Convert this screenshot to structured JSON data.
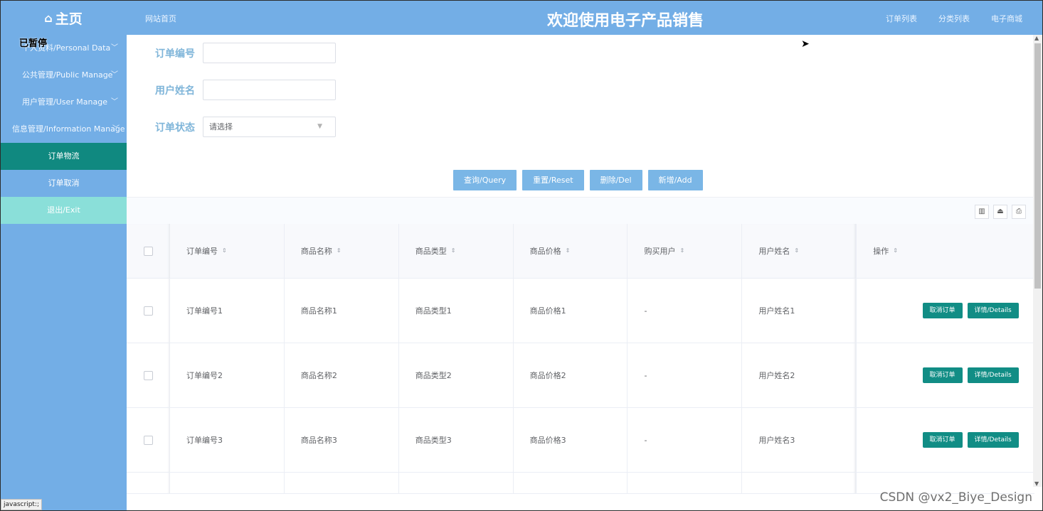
{
  "header": {
    "brand": "主页",
    "home_link": "网站首页",
    "title": "欢迎使用电子产品销售",
    "right_links": [
      "订单列表",
      "分类列表",
      "电子商城"
    ]
  },
  "sidebar": {
    "overlay": "已暂停",
    "groups": [
      {
        "label": "个人资料/Personal Data"
      },
      {
        "label": "公共管理/Public Manage"
      },
      {
        "label": "用户管理/User Manage"
      },
      {
        "label": "信息管理/Information Manage"
      }
    ],
    "subs": [
      {
        "label": "订单物流"
      },
      {
        "label": "订单取消"
      },
      {
        "label": "退出/Exit"
      }
    ],
    "status_url": "javascript:;"
  },
  "form": {
    "order_no_label": "订单编号",
    "user_name_label": "用户姓名",
    "status_label": "订单状态",
    "status_placeholder": "请选择",
    "buttons": [
      "查询/Query",
      "重置/Reset",
      "删除/Del",
      "新增/Add"
    ]
  },
  "table": {
    "columns": [
      "订单编号",
      "商品名称",
      "商品类型",
      "商品价格",
      "购买用户",
      "用户姓名",
      "操作"
    ],
    "rows": [
      [
        "订单编号1",
        "商品名称1",
        "商品类型1",
        "商品价格1",
        "-",
        "用户姓名1"
      ],
      [
        "订单编号2",
        "商品名称2",
        "商品类型2",
        "商品价格2",
        "-",
        "用户姓名2"
      ],
      [
        "订单编号3",
        "商品名称3",
        "商品类型3",
        "商品价格3",
        "-",
        "用户姓名3"
      ]
    ],
    "row_actions": [
      "取消订单",
      "详情/Details"
    ]
  },
  "watermark": "CSDN @vx2_Biye_Design"
}
